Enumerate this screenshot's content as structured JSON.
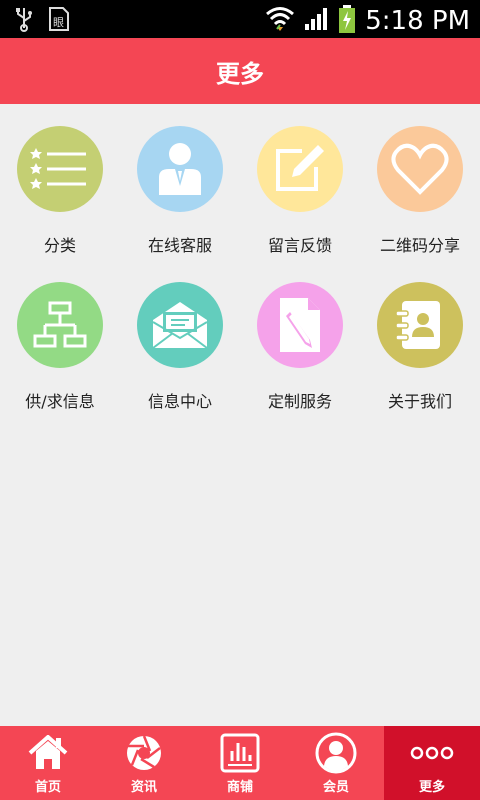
{
  "status_bar": {
    "time": "5:18 PM",
    "icons": [
      "usb-icon",
      "sim-card-icon",
      "wifi-icon",
      "signal-icon",
      "battery-charging-icon"
    ]
  },
  "header": {
    "title": "更多"
  },
  "grid": {
    "items": [
      {
        "label": "分类",
        "icon": "list-stars-icon",
        "color": "#c4cf73"
      },
      {
        "label": "在线客服",
        "icon": "customer-service-icon",
        "color": "#a7d6f2"
      },
      {
        "label": "留言反馈",
        "icon": "edit-note-icon",
        "color": "#ffe79a"
      },
      {
        "label": "二维码分享",
        "icon": "heart-icon",
        "color": "#fbc99a"
      },
      {
        "label": "供/求信息",
        "icon": "hierarchy-icon",
        "color": "#93da85"
      },
      {
        "label": "信息中心",
        "icon": "mail-icon",
        "color": "#63cdbd"
      },
      {
        "label": "定制服务",
        "icon": "document-pen-icon",
        "color": "#f5a2ea"
      },
      {
        "label": "关于我们",
        "icon": "contact-book-icon",
        "color": "#cdc15d"
      }
    ]
  },
  "tabbar": {
    "tabs": [
      {
        "label": "首页",
        "icon": "home-icon"
      },
      {
        "label": "资讯",
        "icon": "aperture-icon"
      },
      {
        "label": "商铺",
        "icon": "store-chart-icon"
      },
      {
        "label": "会员",
        "icon": "member-icon"
      },
      {
        "label": "更多",
        "icon": "more-dots-icon",
        "active": true
      }
    ]
  }
}
